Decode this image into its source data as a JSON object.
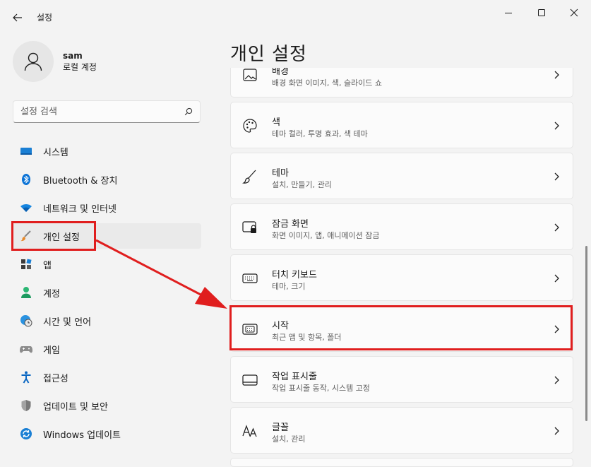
{
  "window": {
    "title": "설정"
  },
  "profile": {
    "name": "sam",
    "account_type": "로컬 계정"
  },
  "search": {
    "placeholder": "설정 검색"
  },
  "sidebar": {
    "items": [
      {
        "label": "시스템",
        "icon": "monitor-icon"
      },
      {
        "label": "Bluetooth & 장치",
        "icon": "bluetooth-icon"
      },
      {
        "label": "네트워크 및 인터넷",
        "icon": "wifi-icon"
      },
      {
        "label": "개인 설정",
        "icon": "brush-icon",
        "selected": true
      },
      {
        "label": "앱",
        "icon": "apps-icon"
      },
      {
        "label": "계정",
        "icon": "person-icon"
      },
      {
        "label": "시간 및 언어",
        "icon": "globe-clock-icon"
      },
      {
        "label": "게임",
        "icon": "gamepad-icon"
      },
      {
        "label": "접근성",
        "icon": "accessibility-icon"
      },
      {
        "label": "업데이트 및 보안",
        "icon": "shield-icon"
      },
      {
        "label": "Windows 업데이트",
        "icon": "update-icon"
      }
    ]
  },
  "main": {
    "title": "개인 설정",
    "cards": [
      {
        "title": "배경",
        "subtitle": "배경 화면 이미지, 색, 슬라이드 쇼",
        "icon": "image-icon"
      },
      {
        "title": "색",
        "subtitle": "테마 컬러, 투명 효과, 색 테마",
        "icon": "palette-icon"
      },
      {
        "title": "테마",
        "subtitle": "설치, 만들기, 관리",
        "icon": "brush-icon"
      },
      {
        "title": "잠금 화면",
        "subtitle": "화면 이미지, 앱, 애니메이션 잠금",
        "icon": "lock-screen-icon"
      },
      {
        "title": "터치 키보드",
        "subtitle": "테마, 크기",
        "icon": "keyboard-icon"
      },
      {
        "title": "시작",
        "subtitle": "최근 앱 및 항목, 폴더",
        "icon": "start-icon"
      },
      {
        "title": "작업 표시줄",
        "subtitle": "작업 표시줄 동작, 시스템 고정",
        "icon": "taskbar-icon"
      },
      {
        "title": "글꼴",
        "subtitle": "설치, 관리",
        "icon": "font-icon"
      }
    ]
  },
  "colors": {
    "accent": "#0067c0",
    "annotation": "#e01e1e"
  }
}
